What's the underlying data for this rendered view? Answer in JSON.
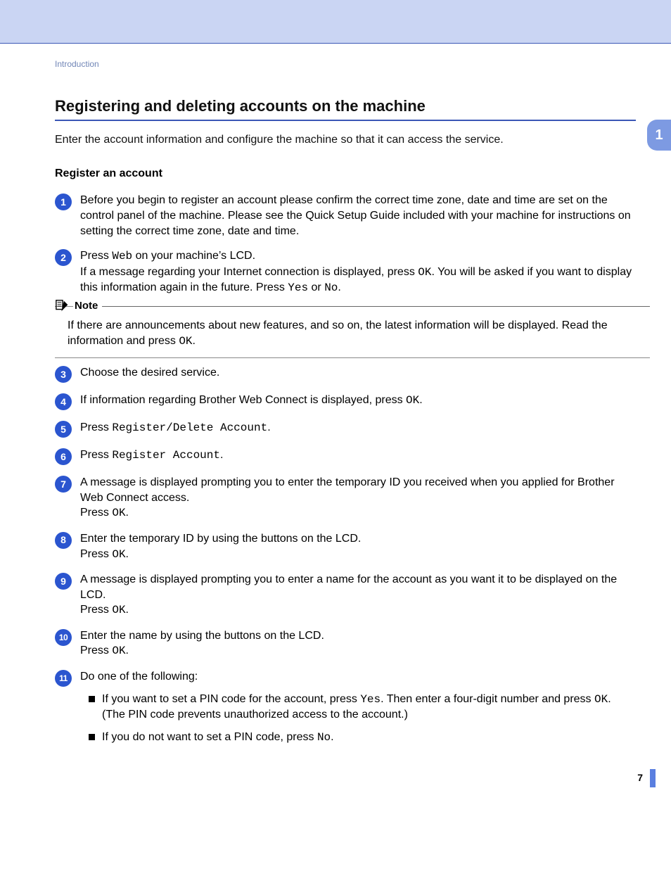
{
  "breadcrumb": "Introduction",
  "section_title": "Registering and deleting accounts on the machine",
  "intro_text": "Enter the account information and configure the machine so that it can access the service.",
  "chapter_tab": "1",
  "subsection_title": "Register an account",
  "note": {
    "label": "Note",
    "body_pre": "If there are announcements about new features, and so on, the latest information will be displayed. Read the information and press ",
    "body_code": "OK",
    "body_post": "."
  },
  "steps": {
    "s1": {
      "num": "1",
      "text": "Before you begin to register an account please confirm the correct time zone, date and time are set on the control panel of the machine. Please see the Quick Setup Guide included with your machine for instructions on setting the correct time zone, date and time."
    },
    "s2": {
      "num": "2",
      "a1": "Press ",
      "c1": "Web",
      "a2": " on your machine’s LCD.",
      "b1": "If a message regarding your Internet connection is displayed, press ",
      "c2": "OK",
      "b2": ". You will be asked if you want to display this information again in the future. Press ",
      "c3": "Yes",
      "b3": " or ",
      "c4": "No",
      "b4": "."
    },
    "s3": {
      "num": "3",
      "text": "Choose the desired service."
    },
    "s4": {
      "num": "4",
      "a": "If information regarding Brother Web Connect is displayed, press ",
      "c": "OK",
      "b": "."
    },
    "s5": {
      "num": "5",
      "a": "Press ",
      "c": "Register/Delete Account",
      "b": "."
    },
    "s6": {
      "num": "6",
      "a": "Press ",
      "c": "Register Account",
      "b": "."
    },
    "s7": {
      "num": "7",
      "a": "A message is displayed prompting you to enter the temporary ID you received when you applied for Brother Web Connect access.",
      "b": "Press ",
      "c": "OK",
      "d": "."
    },
    "s8": {
      "num": "8",
      "a": "Enter the temporary ID by using the buttons on the LCD.",
      "b": "Press ",
      "c": "OK",
      "d": "."
    },
    "s9": {
      "num": "9",
      "a": "A message is displayed prompting you to enter a name for the account as you want it to be displayed on the LCD.",
      "b": "Press ",
      "c": "OK",
      "d": "."
    },
    "s10": {
      "num": "10",
      "a": "Enter the name by using the buttons on the LCD.",
      "b": "Press ",
      "c": "OK",
      "d": "."
    },
    "s11": {
      "num": "11",
      "lead": "Do one of the following:",
      "opt1_a": "If you want to set a PIN code for the account, press ",
      "opt1_c1": "Yes",
      "opt1_b": ". Then enter a four-digit number and press ",
      "opt1_c2": "OK",
      "opt1_d": ". (The PIN code prevents unauthorized access to the account.)",
      "opt2_a": "If you do not want to set a PIN code, press ",
      "opt2_c": "No",
      "opt2_b": "."
    }
  },
  "page_number": "7"
}
